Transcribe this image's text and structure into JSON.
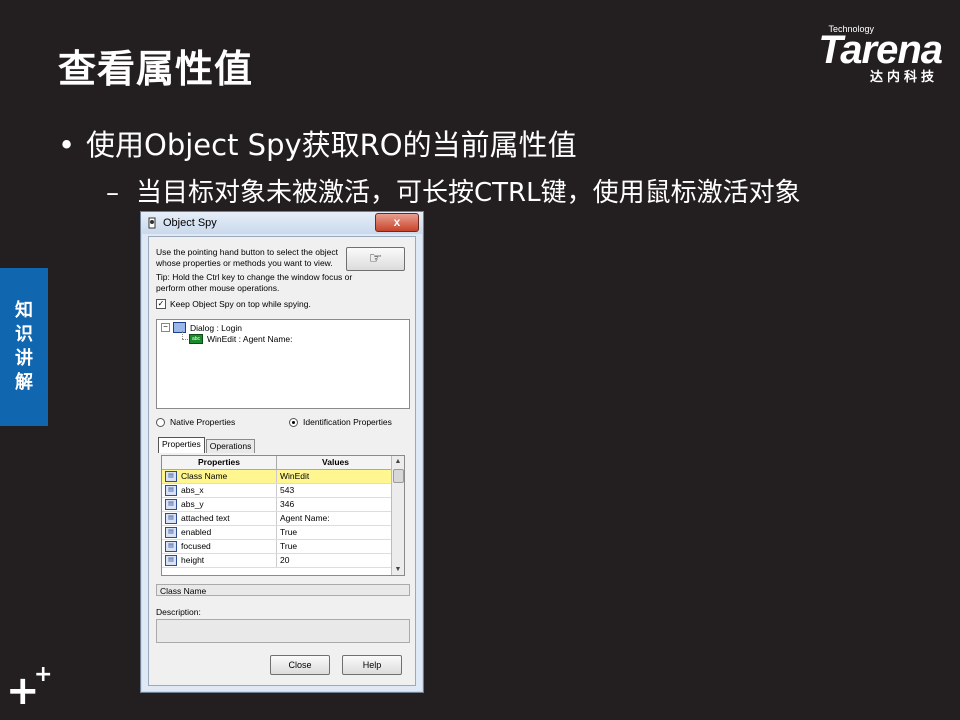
{
  "slide": {
    "title": "查看属性值",
    "bullet1": "使用Object Spy获取RO的当前属性值",
    "bullet1_marker": "•",
    "bullet2": "当目标对象未被激活，可长按CTRL键，使用鼠标激活对象",
    "bullet2_marker": "–",
    "side_tab": [
      "知",
      "识",
      "讲",
      "解"
    ]
  },
  "logo": {
    "technology": "Technology",
    "brand": "Tarena",
    "chinese": "达内科技"
  },
  "window": {
    "title": "Object Spy",
    "close_glyph": "x",
    "instruction": "Use the pointing hand button to select the object whose properties or methods you want to view.",
    "tip": "Tip: Hold the Ctrl key to change the window focus or perform other mouse operations.",
    "hand_glyph": "☞",
    "keep_on_top": "Keep Object Spy on top while spying.",
    "keep_checked": true,
    "tree": [
      {
        "label": "Dialog : Login",
        "expander": "⊟"
      },
      {
        "label": "WinEdit : Agent Name:",
        "icon_text": "abc"
      }
    ],
    "radio_native": "Native Properties",
    "radio_identification": "Identification Properties",
    "selected_radio": "identification",
    "tabs": [
      "Properties",
      "Operations"
    ],
    "active_tab": "Properties",
    "grid_headers": [
      "Properties",
      "Values"
    ],
    "rows": [
      {
        "name": "Class Name",
        "value": "WinEdit",
        "selected": true
      },
      {
        "name": "abs_x",
        "value": "543"
      },
      {
        "name": "abs_y",
        "value": "346"
      },
      {
        "name": "attached text",
        "value": "Agent Name:"
      },
      {
        "name": "enabled",
        "value": "True"
      },
      {
        "name": "focused",
        "value": "True"
      },
      {
        "name": "height",
        "value": "20"
      }
    ],
    "selected_property": "Class Name",
    "description_label": "Description:",
    "close_button": "Close",
    "help_button": "Help"
  },
  "footer_logo": {
    "big": "+",
    "small": "+"
  }
}
